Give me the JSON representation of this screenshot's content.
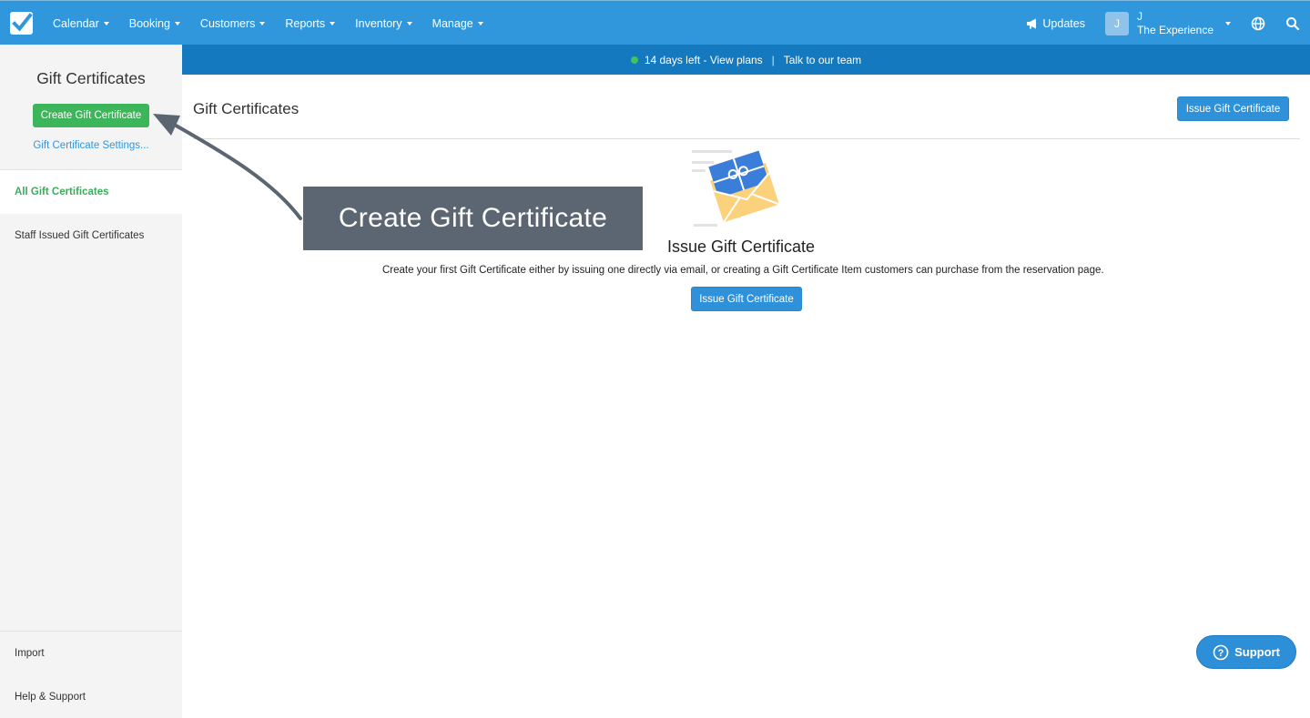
{
  "nav": {
    "items": [
      {
        "label": "Calendar"
      },
      {
        "label": "Booking"
      },
      {
        "label": "Customers"
      },
      {
        "label": "Reports"
      },
      {
        "label": "Inventory"
      },
      {
        "label": "Manage"
      }
    ],
    "updates_label": "Updates",
    "avatar_initial": "J",
    "account_name": "J",
    "account_company": "The Experience"
  },
  "banner": {
    "trial_text": "14 days left - View plans",
    "separator": "|",
    "talk_text": "Talk to our team"
  },
  "sidebar": {
    "title": "Gift Certificates",
    "create_button": "Create Gift Certificate",
    "settings_link": "Gift Certificate Settings...",
    "items": [
      {
        "label": "All Gift Certificates",
        "active": true
      },
      {
        "label": "Staff Issued Gift Certificates",
        "active": false
      }
    ],
    "bottom_items": [
      {
        "label": "Import"
      },
      {
        "label": "Help & Support"
      }
    ]
  },
  "main": {
    "title": "Gift Certificates",
    "issue_button": "Issue Gift Certificate",
    "empty": {
      "title": "Issue Gift Certificate",
      "description": "Create your first Gift Certificate either by issuing one directly via email, or creating a Gift Certificate Item customers can purchase from the reservation page.",
      "button": "Issue Gift Certificate"
    }
  },
  "annotation": {
    "text": "Create Gift Certificate"
  },
  "support": {
    "label": "Support"
  },
  "colors": {
    "nav_blue": "#3197dd",
    "banner_blue": "#1479be",
    "green": "#3db55b",
    "callout": "#5c6672"
  }
}
